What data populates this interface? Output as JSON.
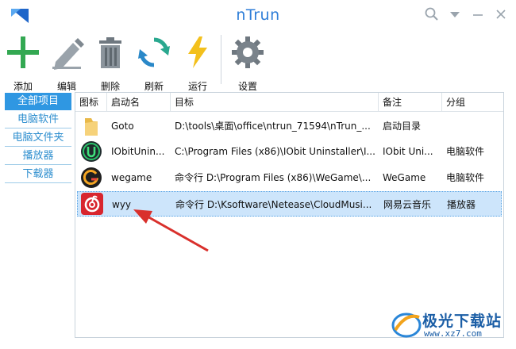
{
  "window": {
    "title": "nTrun",
    "controls": [
      "search-icon",
      "dropdown-icon",
      "minimize-icon",
      "close-icon"
    ]
  },
  "toolbar": {
    "add": "添加",
    "edit": "编辑",
    "delete": "删除",
    "refresh": "刷新",
    "run": "运行",
    "settings": "设置"
  },
  "sidebar": {
    "items": [
      {
        "label": "全部项目",
        "active": true
      },
      {
        "label": "电脑软件",
        "active": false
      },
      {
        "label": "电脑文件夹",
        "active": false
      },
      {
        "label": "播放器",
        "active": false
      },
      {
        "label": "下载器",
        "active": false
      }
    ]
  },
  "table": {
    "headers": {
      "icon": "图标",
      "name": "启动名",
      "target": "目标",
      "note": "备注",
      "group": "分组"
    },
    "rows": [
      {
        "icon": "folder-icon",
        "name": "Goto",
        "target": "D:\\tools\\桌面\\office\\ntrun_71594\\nTrun_...",
        "note": "启动目录",
        "group": ""
      },
      {
        "icon": "iobit-uninstaller-icon",
        "name": "IObitUnin...",
        "target": "C:\\Program Files (x86)\\IObit Uninstaller\\I...",
        "note": "IObit Uni...",
        "group": "电脑软件"
      },
      {
        "icon": "wegame-icon",
        "name": "wegame",
        "target": "命令行 D:\\Program Files (x86)\\WeGame\\...",
        "note": "WeGame",
        "group": "电脑软件"
      },
      {
        "icon": "netease-cloudmusic-icon",
        "name": "wyy",
        "target": "命令行 D:\\Ksoftware\\Netease\\CloudMusi...",
        "note": "网易云音乐",
        "group": "播放器",
        "selected": true
      }
    ]
  },
  "watermark": {
    "brand": "极光下载站",
    "url": "www.xz7.com"
  },
  "colors": {
    "accent": "#2f97e2",
    "title": "#2f7ed8",
    "selection": "#cde5fb",
    "arrow": "#d9302c"
  }
}
